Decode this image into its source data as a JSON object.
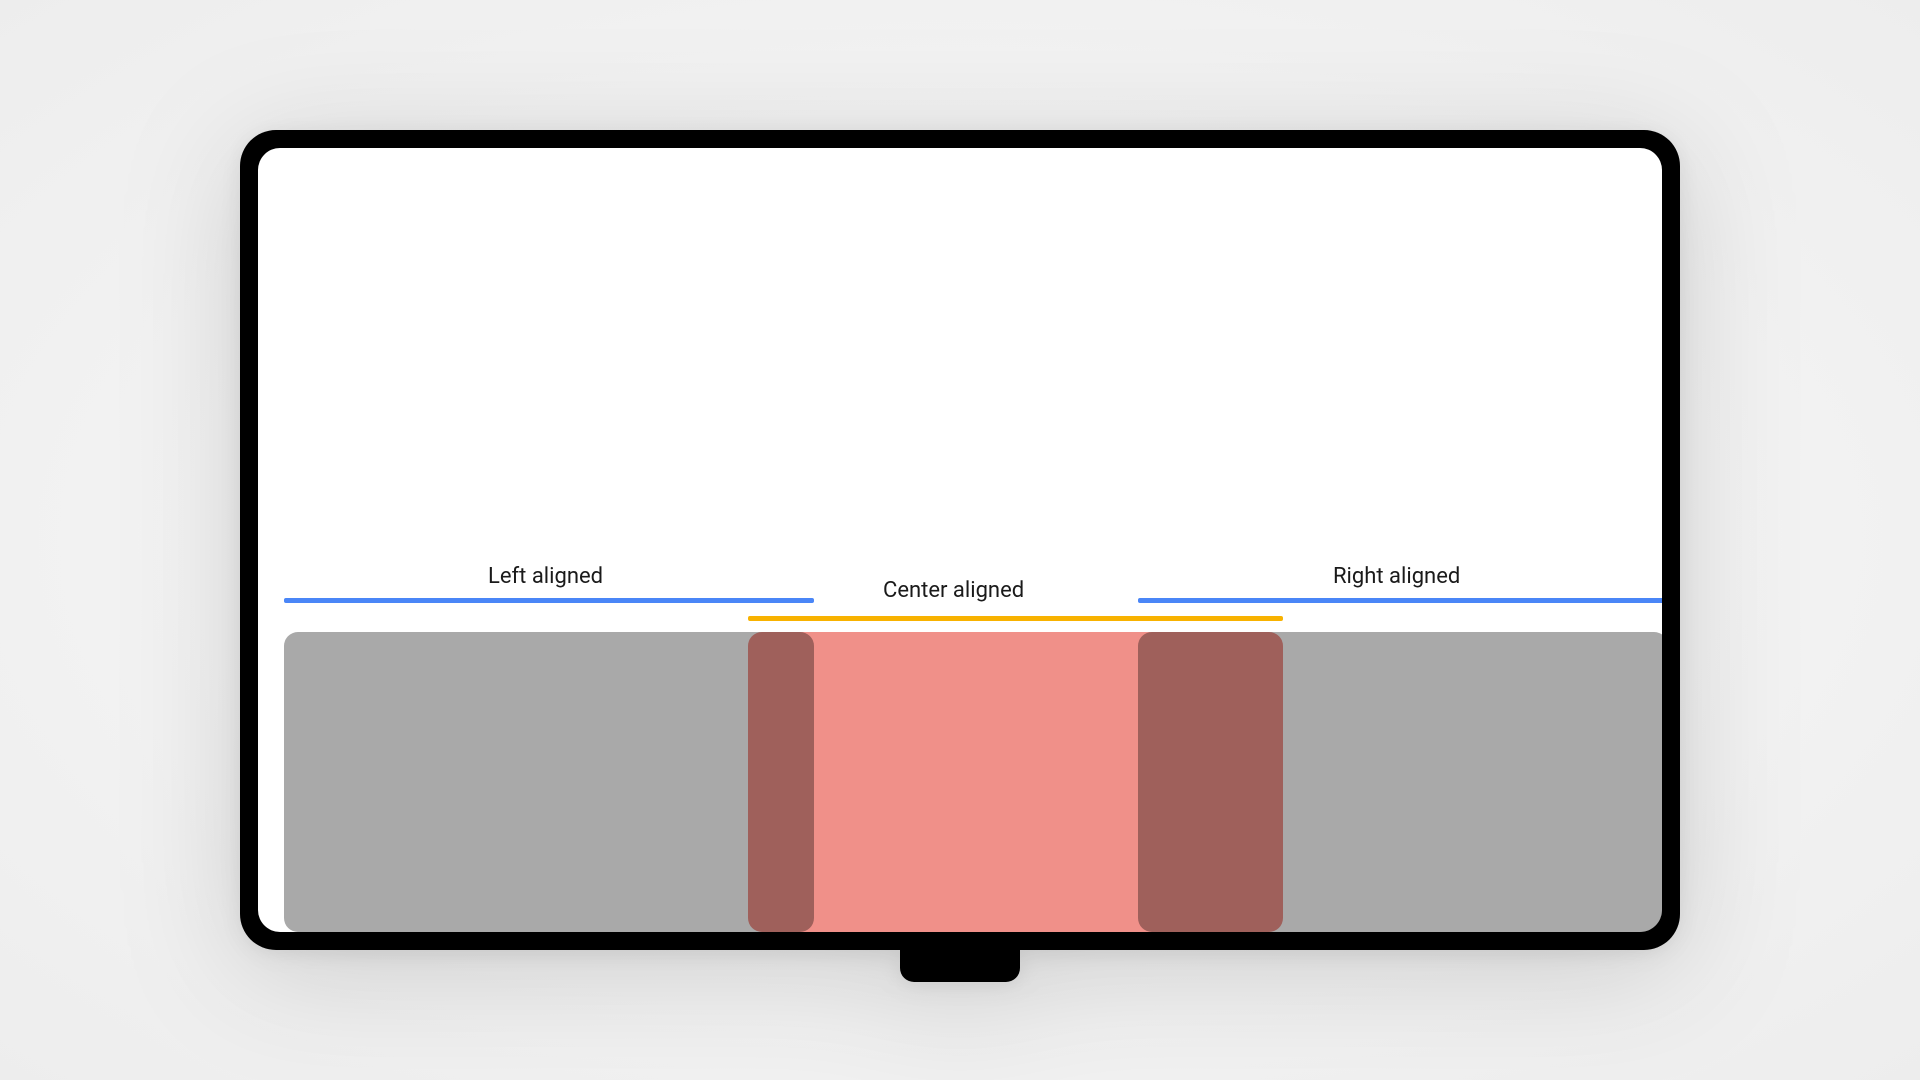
{
  "labels": {
    "left": "Left aligned",
    "center": "Center aligned",
    "right": "Right aligned"
  },
  "colors": {
    "blue": "#4a86f7",
    "orange": "#f8b200",
    "gray": "#a9a9a9",
    "red": "#f08a83"
  }
}
